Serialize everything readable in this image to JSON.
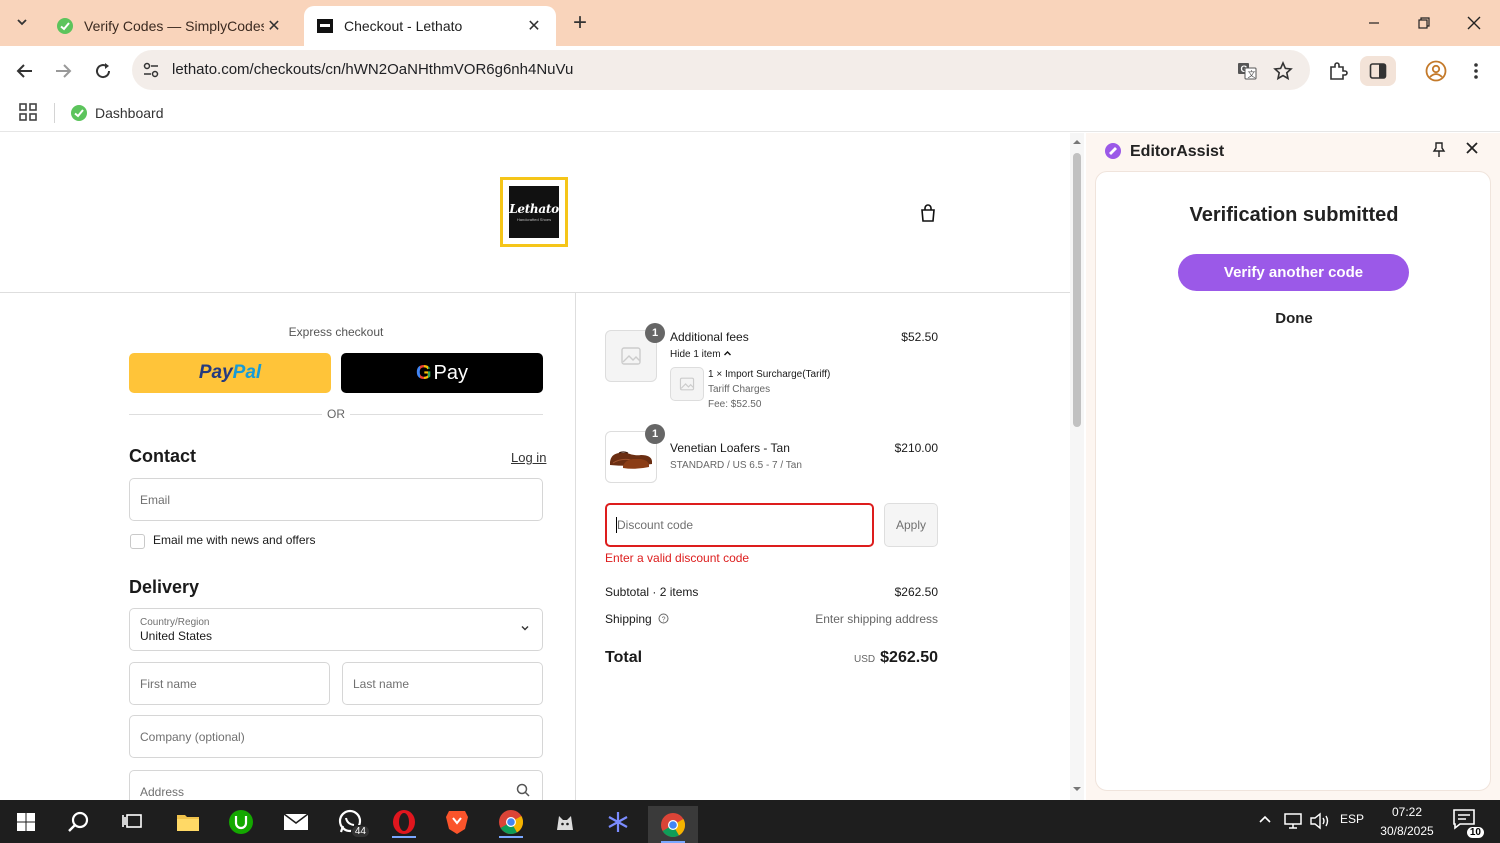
{
  "browser": {
    "tabs": [
      {
        "title": "Verify Codes — SimplyCodes",
        "active": false
      },
      {
        "title": "Checkout - Lethato",
        "active": true
      }
    ],
    "url": "lethato.com/checkouts/cn/hWN2OaNHthmVOR6g6nh4NuVu",
    "bookmarks": [
      {
        "label": "Dashboard"
      }
    ]
  },
  "store": {
    "logo_text": "Lethato",
    "logo_subtext": "Handcrafted Shoes"
  },
  "checkout": {
    "express_label": "Express checkout",
    "or_text": "OR",
    "paypal_pay": "Pay",
    "paypal_pal": "Pal",
    "gpay_g": "G",
    "gpay_pay": "Pay",
    "contact_title": "Contact",
    "login_label": "Log in",
    "email_placeholder": "Email",
    "newsletter_label": "Email me with news and offers",
    "delivery_title": "Delivery",
    "country_label": "Country/Region",
    "country_value": "United States",
    "first_name_placeholder": "First name",
    "last_name_placeholder": "Last name",
    "company_placeholder": "Company (optional)",
    "address_placeholder": "Address"
  },
  "summary": {
    "items": [
      {
        "qty": "1",
        "name": "Additional fees",
        "toggle": "Hide 1 item",
        "price": "$52.50",
        "sub_item": {
          "line": "1 × Import Surcharge(Tariff)",
          "detail": "Tariff Charges",
          "fee": "Fee: $52.50"
        }
      },
      {
        "qty": "1",
        "name": "Venetian Loafers - Tan",
        "variant": "STANDARD / US 6.5 - 7 / Tan",
        "price": "$210.00"
      }
    ],
    "discount_placeholder": "Discount code",
    "apply_label": "Apply",
    "error": "Enter a valid discount code",
    "subtotal_label": "Subtotal · 2 items",
    "subtotal_value": "$262.50",
    "shipping_label": "Shipping",
    "shipping_value": "Enter shipping address",
    "total_label": "Total",
    "currency": "USD",
    "total_value": "$262.50"
  },
  "side_panel": {
    "title": "EditorAssist",
    "heading": "Verification submitted",
    "primary_button": "Verify another code",
    "done_label": "Done",
    "accent_color": "#9b59e8"
  },
  "taskbar": {
    "whatsapp_badge": "44",
    "language": "ESP",
    "time": "07:22",
    "date": "30/8/2025",
    "notification_count": "10"
  }
}
